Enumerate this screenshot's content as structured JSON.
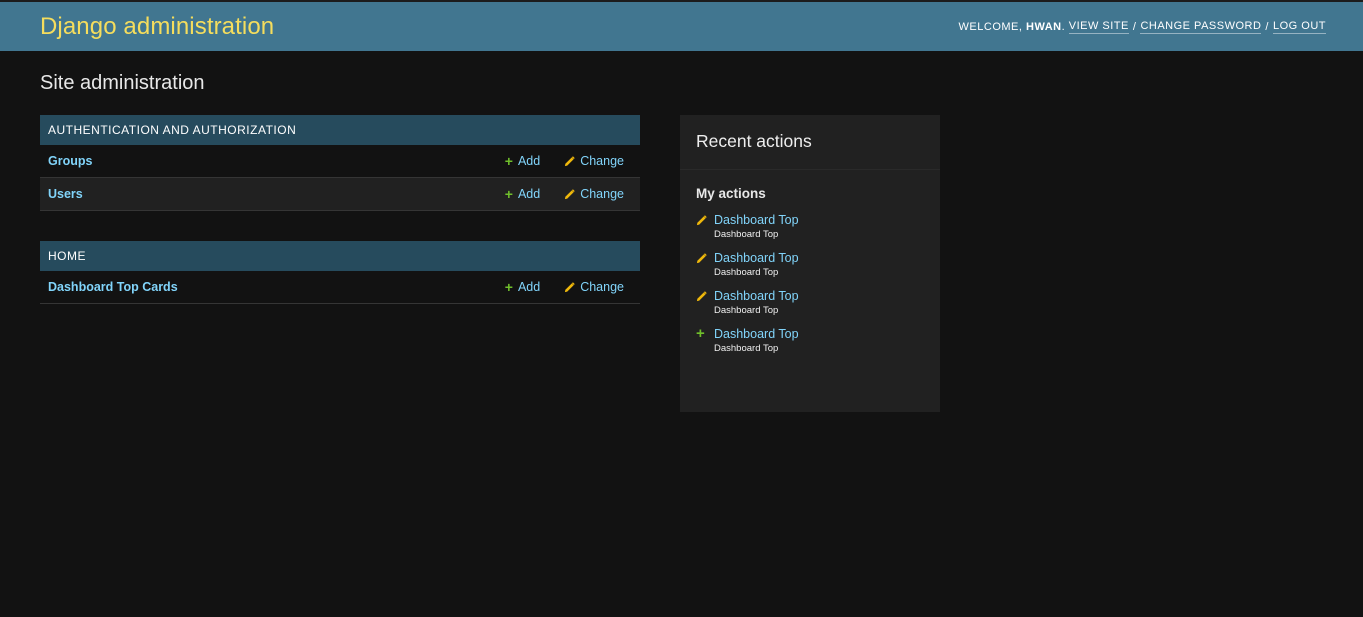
{
  "header": {
    "branding": "Django administration",
    "welcome": "WELCOME,",
    "username": "HWAN",
    "view_site": "VIEW SITE",
    "change_password": "CHANGE PASSWORD",
    "log_out": "LOG OUT"
  },
  "page_title": "Site administration",
  "apps": [
    {
      "caption": "AUTHENTICATION AND AUTHORIZATION",
      "models": [
        {
          "name": "Groups",
          "add": "Add",
          "change": "Change"
        },
        {
          "name": "Users",
          "add": "Add",
          "change": "Change"
        }
      ]
    },
    {
      "caption": "HOME",
      "models": [
        {
          "name": "Dashboard Top Cards",
          "add": "Add",
          "change": "Change"
        }
      ]
    }
  ],
  "recent": {
    "title": "Recent actions",
    "subtitle": "My actions",
    "items": [
      {
        "type": "change",
        "label": "Dashboard Top",
        "content_type": "Dashboard Top"
      },
      {
        "type": "change",
        "label": "Dashboard Top",
        "content_type": "Dashboard Top"
      },
      {
        "type": "change",
        "label": "Dashboard Top",
        "content_type": "Dashboard Top"
      },
      {
        "type": "add",
        "label": "Dashboard Top",
        "content_type": "Dashboard Top"
      }
    ]
  },
  "colors": {
    "header_bg": "#417690",
    "branding": "#f5dd5d",
    "module_caption_bg": "#264b5d",
    "link": "#81d4fa",
    "add_icon": "#70bf2b",
    "change_icon": "#efb80b",
    "background": "#121212"
  },
  "icons": {
    "add": "plus-icon",
    "change": "pencil-icon"
  }
}
